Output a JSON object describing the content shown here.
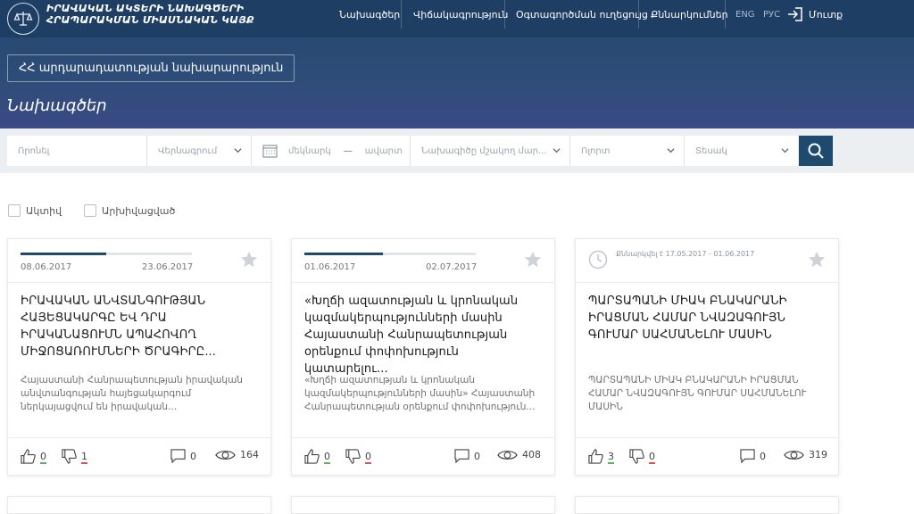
{
  "header": {
    "logo_line1": "ԻՐԱՎԱԿԱՆ ԱԿՏԵՐԻ ՆԱԽԱԳԾԵՐԻ",
    "logo_line2": "ՀՐԱՊԱՐԱԿՄԱՆ ՄԻԱՍՆԱԿԱՆ ԿԱՅՔ",
    "nav": [
      {
        "label": "Նախագծեր"
      },
      {
        "label": "Վիճակագրություն"
      },
      {
        "label": "Օգտագործման ուղեցույց"
      },
      {
        "label": "Քննարկումներ"
      }
    ],
    "lang_eng": "ENG",
    "lang_rus": "РУС",
    "login_label": "Մուտք"
  },
  "hero": {
    "ministry": "ՀՀ արդարադատության նախարարություն",
    "title": "Նախագծեր"
  },
  "filters": {
    "search_placeholder": "Որոնել",
    "title_select": "Վերնագրում",
    "date_from": "մեկնարկ",
    "date_dash": "—",
    "date_to": "ավարտ",
    "proposer_select": "Նախագիծը մշակող մար...",
    "sphere_select": "Ոլորտ",
    "type_select": "Տեսակ"
  },
  "checkboxes": {
    "active": "Ակտիվ",
    "archived": "Արխիվացված"
  },
  "cards": [
    {
      "start": "08.06.2017",
      "end": "23.06.2017",
      "progress": 0.5,
      "title": "ԻՐԱՎԱԿԱՆ ԱՆՎՏԱՆԳՈՒԹՅԱՆ ՀԱՅԵՑԱԿԱՐԳԸ ԵՎ ԴՐԱ ԻՐԱԿԱՆԱՑՈՒՄՆ ԱՊԱՀՈՎՈՂ ՄԻՋՈՑԱՌՈՒՄՆԵՐԻ ԾՐԱԳԻՐԸ...",
      "desc": "Հայաստանի Հանրապետության իրավական անվտանգության հայեցակարգում ներկայացվում են իրավական...",
      "likes": "0",
      "dislikes": "1",
      "comments": "0",
      "views": "164"
    },
    {
      "start": "01.06.2017",
      "end": "02.07.2017",
      "progress": 0.46,
      "title": "«Խղճի ազատության և կրոնական կազմակերպությունների մասին Հայաստանի Հանրապետության օրենքում փոփոխություն կատարելու...",
      "desc": "«Խղճի ազատության և կրոնական կազմակերպությունների մասին» Հայաստանի Հանրապետության օրենքում փոփոխություն...",
      "likes": "0",
      "dislikes": "0",
      "comments": "0",
      "views": "408"
    },
    {
      "ended_label": "Քննարկվել է 17.05.2017 - 01.06.2017",
      "title": "ՊԱՐՏԱՊԱՆԻ ՄԻԱԿ ԲՆԱԿԱՐԱՆԻ ԻՐԱՑՄԱՆ ՀԱՄԱՐ ՆՎԱԶԱԳՈՒՅՆ ԳՈՒՄԱՐ ՍԱՀՄԱՆԵԼՈՒ ՄԱՍԻՆ",
      "desc": "ՊԱՐՏԱՊԱՆԻ ՄԻԱԿ ԲՆԱԿԱՐԱՆԻ ԻՐԱՑՄԱՆ ՀԱՄԱՐ ՆՎԱԶԱԳՈՒՅՆ ԳՈՒՄԱՐ ՍԱՀՄԱՆԵԼՈՒ ՄԱՍԻՆ",
      "likes": "3",
      "dislikes": "0",
      "comments": "0",
      "views": "319"
    }
  ],
  "colors": {
    "header_bg": "#1e3e64",
    "hero_bg": "#2f4c79",
    "accent": "#1e4a70",
    "like": "#5ab55a",
    "dislike": "#d9534f"
  },
  "icons": [
    "scales-logo-icon",
    "login-icon",
    "calendar-icon",
    "chevron-down-icon",
    "search-icon",
    "star-icon",
    "clock-icon",
    "thumbs-up-icon",
    "thumbs-down-icon",
    "comment-icon",
    "eye-icon"
  ]
}
